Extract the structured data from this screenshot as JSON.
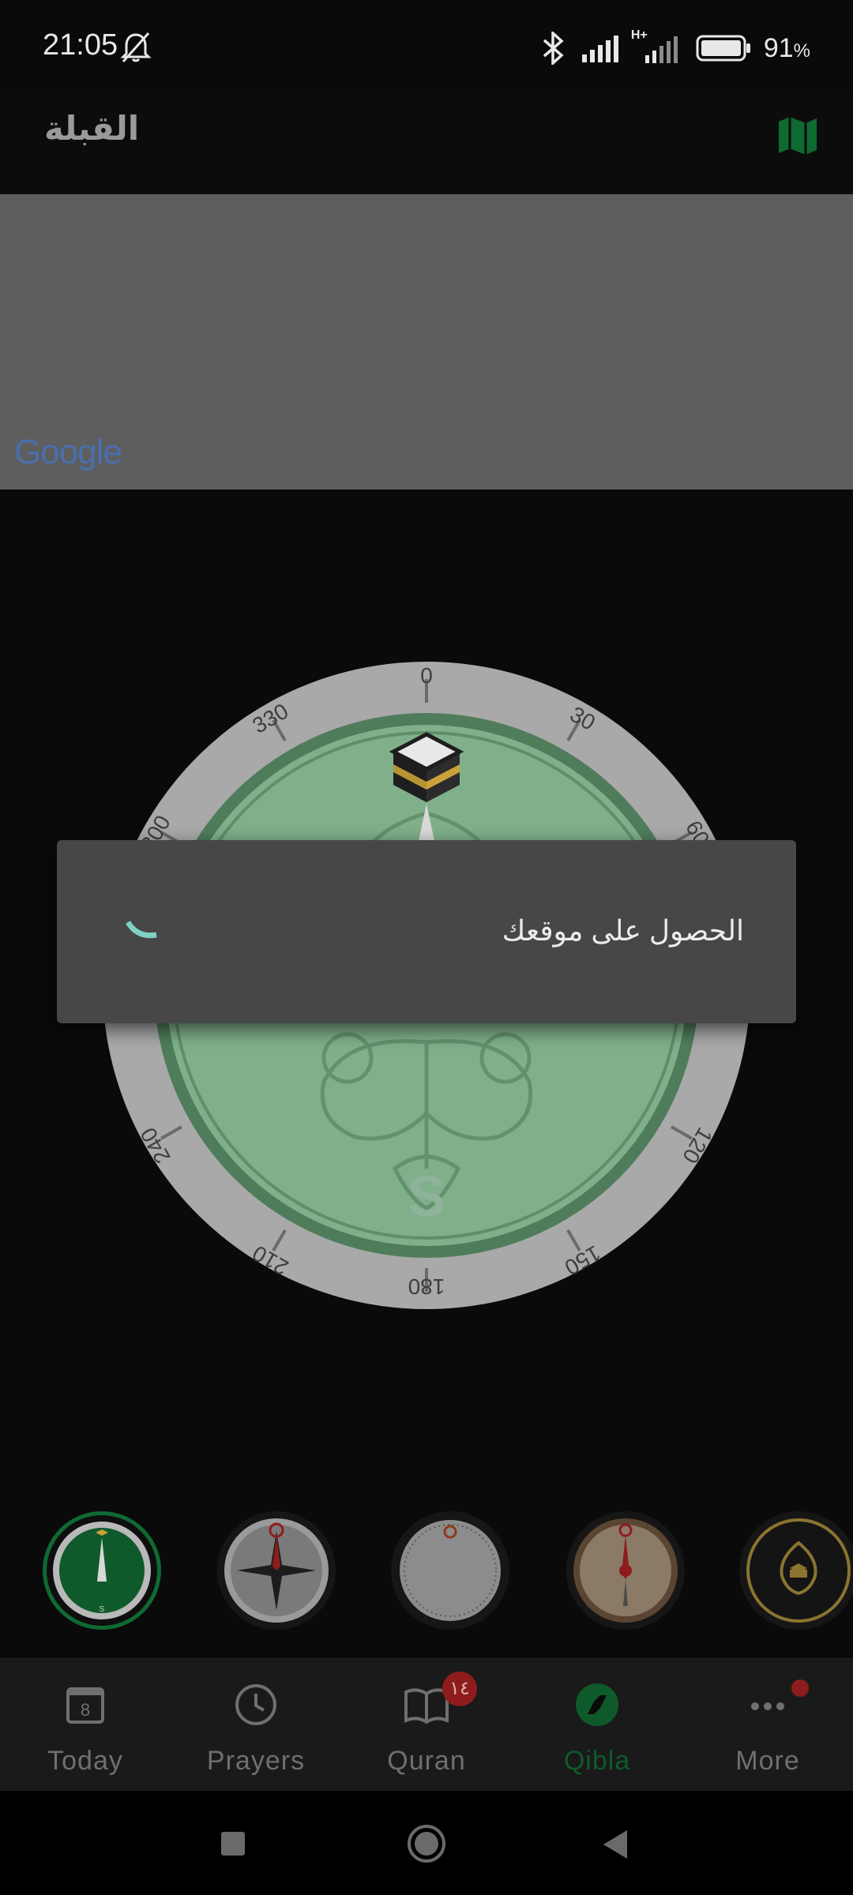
{
  "status_bar": {
    "time": "21:05",
    "network_label": "H+",
    "battery_percent": "91"
  },
  "app_bar": {
    "title": "القبلة",
    "map_icon": "map-icon"
  },
  "ad_banner": {
    "logo_text": "Google"
  },
  "compass": {
    "degree_labels": [
      "0",
      "30",
      "60",
      "120",
      "150",
      "180",
      "210",
      "240",
      "330",
      "300"
    ],
    "south_letter": "S",
    "colors": {
      "ring": "#a8a8a8",
      "face": "#7fb08a",
      "kaaba": "#1e1e1e",
      "kaaba_band": "#c9a33a"
    }
  },
  "dialog": {
    "message": "الحصول على موقعك",
    "spinner_color": "#7fd1c5"
  },
  "compass_styles": [
    {
      "name": "green-classic",
      "selected": true
    },
    {
      "name": "red-star",
      "selected": false
    },
    {
      "name": "white-minimal",
      "selected": false
    },
    {
      "name": "wood-red",
      "selected": false
    },
    {
      "name": "gold-black",
      "selected": false
    }
  ],
  "bottom_nav": {
    "items": [
      {
        "label": "Today",
        "icon": "calendar-icon",
        "calendar_day": "8"
      },
      {
        "label": "Prayers",
        "icon": "clock-icon"
      },
      {
        "label": "Quran",
        "icon": "book-icon",
        "badge": "١٤"
      },
      {
        "label": "Qibla",
        "icon": "compass-icon",
        "active": true
      },
      {
        "label": "More",
        "icon": "more-icon",
        "dot": true
      }
    ],
    "active_color": "#0f5a2a"
  },
  "system_nav": {
    "buttons": [
      "recents-button",
      "home-button",
      "back-button"
    ]
  }
}
